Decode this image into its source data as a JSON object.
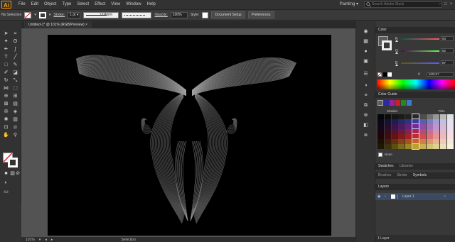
{
  "app": {
    "logo": "Ai",
    "workspace": "Painting",
    "search_placeholder": "Search Adobe Stock"
  },
  "menus": [
    "File",
    "Edit",
    "Object",
    "Type",
    "Select",
    "Effect",
    "View",
    "Window",
    "Help"
  ],
  "control_bar": {
    "selection_label": "No Selection",
    "stroke_label": "Stroke:",
    "stroke_weight": "1 pt",
    "profile_label": "Uniform",
    "opacity_label": "Opacity:",
    "opacity_value": "100%",
    "style_label": "Style:",
    "doc_setup": "Document Setup",
    "preferences": "Preferences"
  },
  "document": {
    "tab_title": "Untitled-1* @ 101% (RGB/Preview)"
  },
  "status": {
    "zoom": "101%",
    "mode": "Selection"
  },
  "color_panel": {
    "title": "Color",
    "r": "93",
    "g": "92",
    "b": "87",
    "hex_prefix": "#",
    "hex": "5d5c57"
  },
  "color_guide": {
    "title": "Color Guide",
    "shades_label": "Shades",
    "tints_label": "Tints",
    "none_label": "None"
  },
  "tabs_row1": [
    "Swatches",
    "Libraries"
  ],
  "tabs_row2": [
    "Brushes",
    "Stroke",
    "Symbols"
  ],
  "layers": {
    "title": "Layers",
    "layer_name": "Layer 1",
    "footer": "1 Layer"
  },
  "colors": {
    "accent_layer": "#3a6fd8",
    "orange": "#ff9a00"
  }
}
